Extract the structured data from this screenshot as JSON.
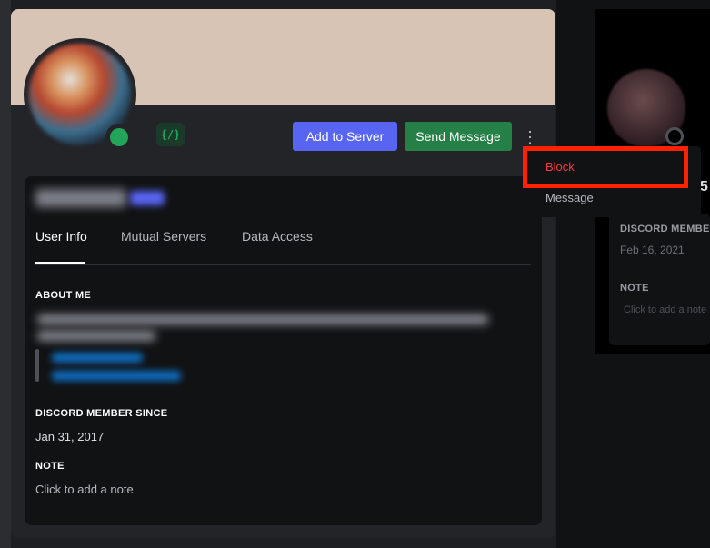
{
  "profile": {
    "badge_text": "{/}",
    "status_color": "#23a559",
    "buttons": {
      "add_to_server": "Add to Server",
      "send_message": "Send Message"
    },
    "more_icon": "⋮",
    "tabs": [
      "User Info",
      "Mutual Servers",
      "Data Access"
    ],
    "active_tab": "User Info",
    "sections": {
      "about_me_label": "ABOUT ME",
      "member_since_label": "DISCORD MEMBER SINCE",
      "member_since_value": "Jan 31, 2017",
      "note_label": "NOTE",
      "note_placeholder": "Click to add a note"
    }
  },
  "context_menu": {
    "items": [
      {
        "label": "Block",
        "color": "#f23f42",
        "highlighted": true
      },
      {
        "label": "Message"
      }
    ],
    "highlight_color": "#ff2200"
  },
  "background_profile": {
    "member_since_label": "DISCORD MEMBE",
    "member_since_value": "Feb 16, 2021",
    "note_label": "NOTE",
    "note_placeholder": "Click to add a note"
  },
  "colors": {
    "accent_blurple": "#5865f2",
    "accent_green": "#248046"
  }
}
